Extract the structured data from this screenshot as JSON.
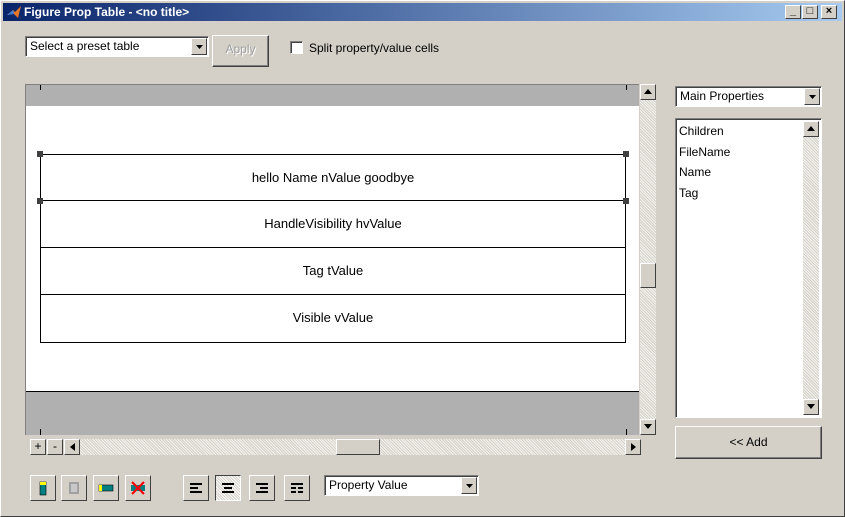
{
  "window": {
    "title": "Figure Prop Table - <no title>",
    "controls": {
      "minimize": "_",
      "maximize": "□",
      "close": "×"
    }
  },
  "toolbar": {
    "preset_select_value": "Select a preset table",
    "apply_label": "Apply",
    "split_checkbox_label": "Split property/value cells",
    "split_checked": false
  },
  "table": {
    "rows": [
      "hello Name nValue goodbye",
      "HandleVisibility hvValue",
      "Tag tValue",
      "Visible vValue"
    ]
  },
  "canvas_controls": {
    "plus_label": "+",
    "minus_label": "-"
  },
  "properties_panel": {
    "category_select_value": "Main Properties",
    "items": [
      "Children",
      "FileName",
      "Name",
      "Tag"
    ],
    "add_label": "<< Add"
  },
  "bottom_toolbar": {
    "insert_mode_select_value": "Property Value",
    "alignment_selected": "center"
  },
  "colors": {
    "title_gradient_start": "#0a246a",
    "title_gradient_end": "#a6caf0",
    "window_bg": "#d4d0c8",
    "band_gray": "#b0b0b0"
  }
}
